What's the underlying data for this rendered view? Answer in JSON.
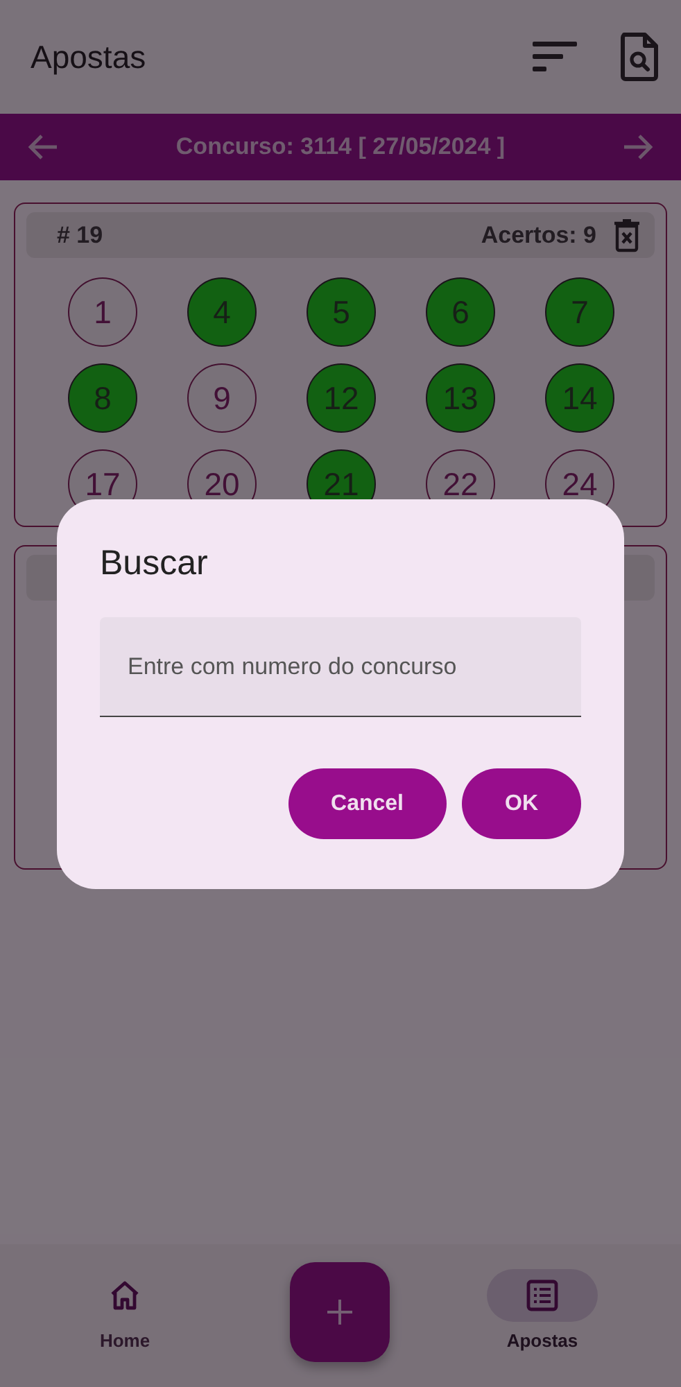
{
  "app_bar": {
    "title": "Apostas"
  },
  "contest_bar": {
    "label": "Concurso: 3114 [ 27/05/2024 ]"
  },
  "bets": [
    {
      "number": "# 19",
      "hits": "Acertos: 9",
      "balls": [
        {
          "value": "1",
          "hit": false
        },
        {
          "value": "4",
          "hit": true
        },
        {
          "value": "5",
          "hit": true
        },
        {
          "value": "6",
          "hit": true
        },
        {
          "value": "7",
          "hit": true
        },
        {
          "value": "8",
          "hit": true
        },
        {
          "value": "9",
          "hit": false
        },
        {
          "value": "12",
          "hit": true
        },
        {
          "value": "13",
          "hit": true
        },
        {
          "value": "14",
          "hit": true
        },
        {
          "value": "17",
          "hit": false
        },
        {
          "value": "20",
          "hit": false
        },
        {
          "value": "21",
          "hit": true
        },
        {
          "value": "22",
          "hit": false
        },
        {
          "value": "24",
          "hit": false
        }
      ]
    }
  ],
  "dialog": {
    "title": "Buscar",
    "placeholder": "Entre com numero do concurso",
    "buttons": [
      "Cancel",
      "OK"
    ]
  },
  "bottom_nav": {
    "items": [
      {
        "label": "Home",
        "kind": "home",
        "selected": false
      },
      {
        "label": "Apostas",
        "kind": "list",
        "selected": true
      }
    ]
  }
}
